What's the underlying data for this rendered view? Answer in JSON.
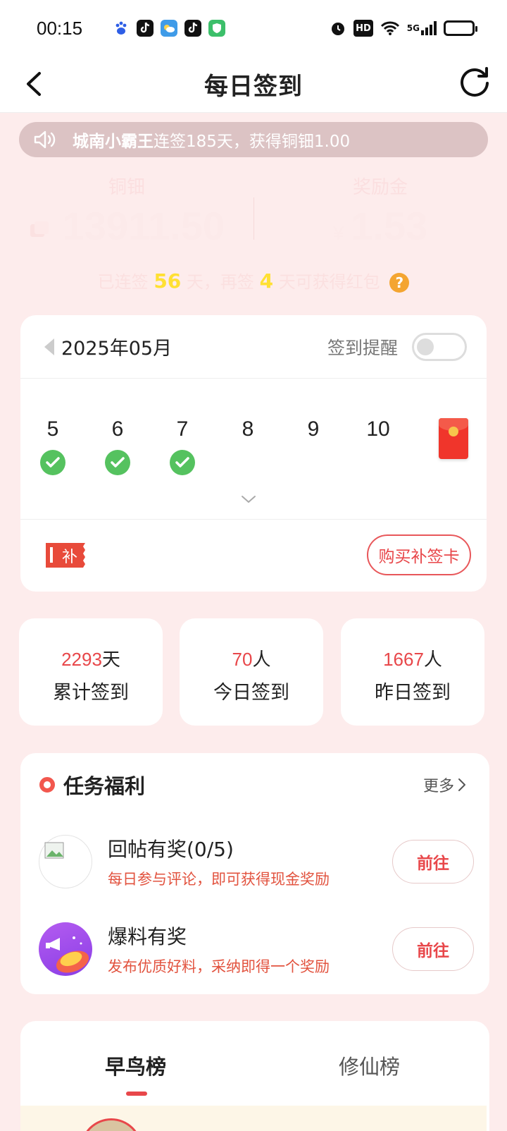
{
  "status_bar": {
    "time": "00:15",
    "apps": [
      "baidu-icon",
      "tiktok-icon",
      "weather-icon",
      "tiktok-icon",
      "security-icon"
    ],
    "hd": "HD",
    "network": "5G"
  },
  "header": {
    "title": "每日签到"
  },
  "ticker": {
    "username": "城南小霸王",
    "message": "连签185天，获得铜钿1.00"
  },
  "balances": {
    "coins_label": "铜钿",
    "coins_value": "13911.50",
    "bonus_label": "奖励金",
    "bonus_prefix": "¥",
    "bonus_value": "1.53"
  },
  "streak": {
    "prefix": "已连签",
    "days": "56",
    "mid": "天，再签",
    "remaining": "4",
    "suffix": "天可获得红包",
    "help": "?"
  },
  "calendar": {
    "month": "2025年05月",
    "remind_label": "签到提醒",
    "remind_on": false,
    "days": [
      {
        "num": "5",
        "checked": true
      },
      {
        "num": "6",
        "checked": true
      },
      {
        "num": "7",
        "checked": true
      },
      {
        "num": "8",
        "checked": false
      },
      {
        "num": "9",
        "checked": false
      },
      {
        "num": "10",
        "checked": false
      }
    ],
    "buy_card_label": "购买补签卡",
    "makeup_icon_text": "补"
  },
  "stats": [
    {
      "value": "2293",
      "unit": "天",
      "label": "累计签到"
    },
    {
      "value": "70",
      "unit": "人",
      "label": "今日签到"
    },
    {
      "value": "1667",
      "unit": "人",
      "label": "昨日签到"
    }
  ],
  "tasks": {
    "title": "任务福利",
    "more": "更多",
    "items": [
      {
        "name": "回帖有奖(0/5)",
        "desc": "每日参与评论，即可获得现金奖励",
        "button": "前往"
      },
      {
        "name": "爆料有奖",
        "desc": "发布优质好料，采纳即得一个奖励",
        "button": "前往"
      }
    ]
  },
  "leaderboard": {
    "tabs": [
      "早鸟榜",
      "修仙榜"
    ],
    "active": 0
  },
  "colors": {
    "accent": "#e8474a",
    "check": "#55c25f",
    "background": "#fdecec",
    "highlight": "#ffe033"
  }
}
